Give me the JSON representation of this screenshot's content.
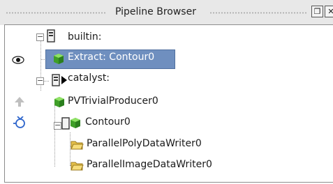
{
  "panel": {
    "title": "Pipeline Browser"
  },
  "window_buttons": {
    "float": "❐",
    "close": "✕"
  },
  "tree": {
    "builtin": "builtin:",
    "extract": "Extract: Contour0",
    "catalyst": "catalyst:",
    "producer": "PVTrivialProducer0",
    "contour": "Contour0",
    "writer1": "ParallelPolyDataWriter0",
    "writer2": "ParallelImageDataWriter0"
  },
  "icons": {
    "eye": "eye-icon",
    "server": "server-icon",
    "play": "play-icon",
    "cube": "green-cube-icon",
    "folder": "open-folder-icon",
    "link": "link-icon"
  },
  "colors": {
    "selection": "#6f8fbf",
    "cube": "#4caf32",
    "folder": "#e7c24b"
  }
}
